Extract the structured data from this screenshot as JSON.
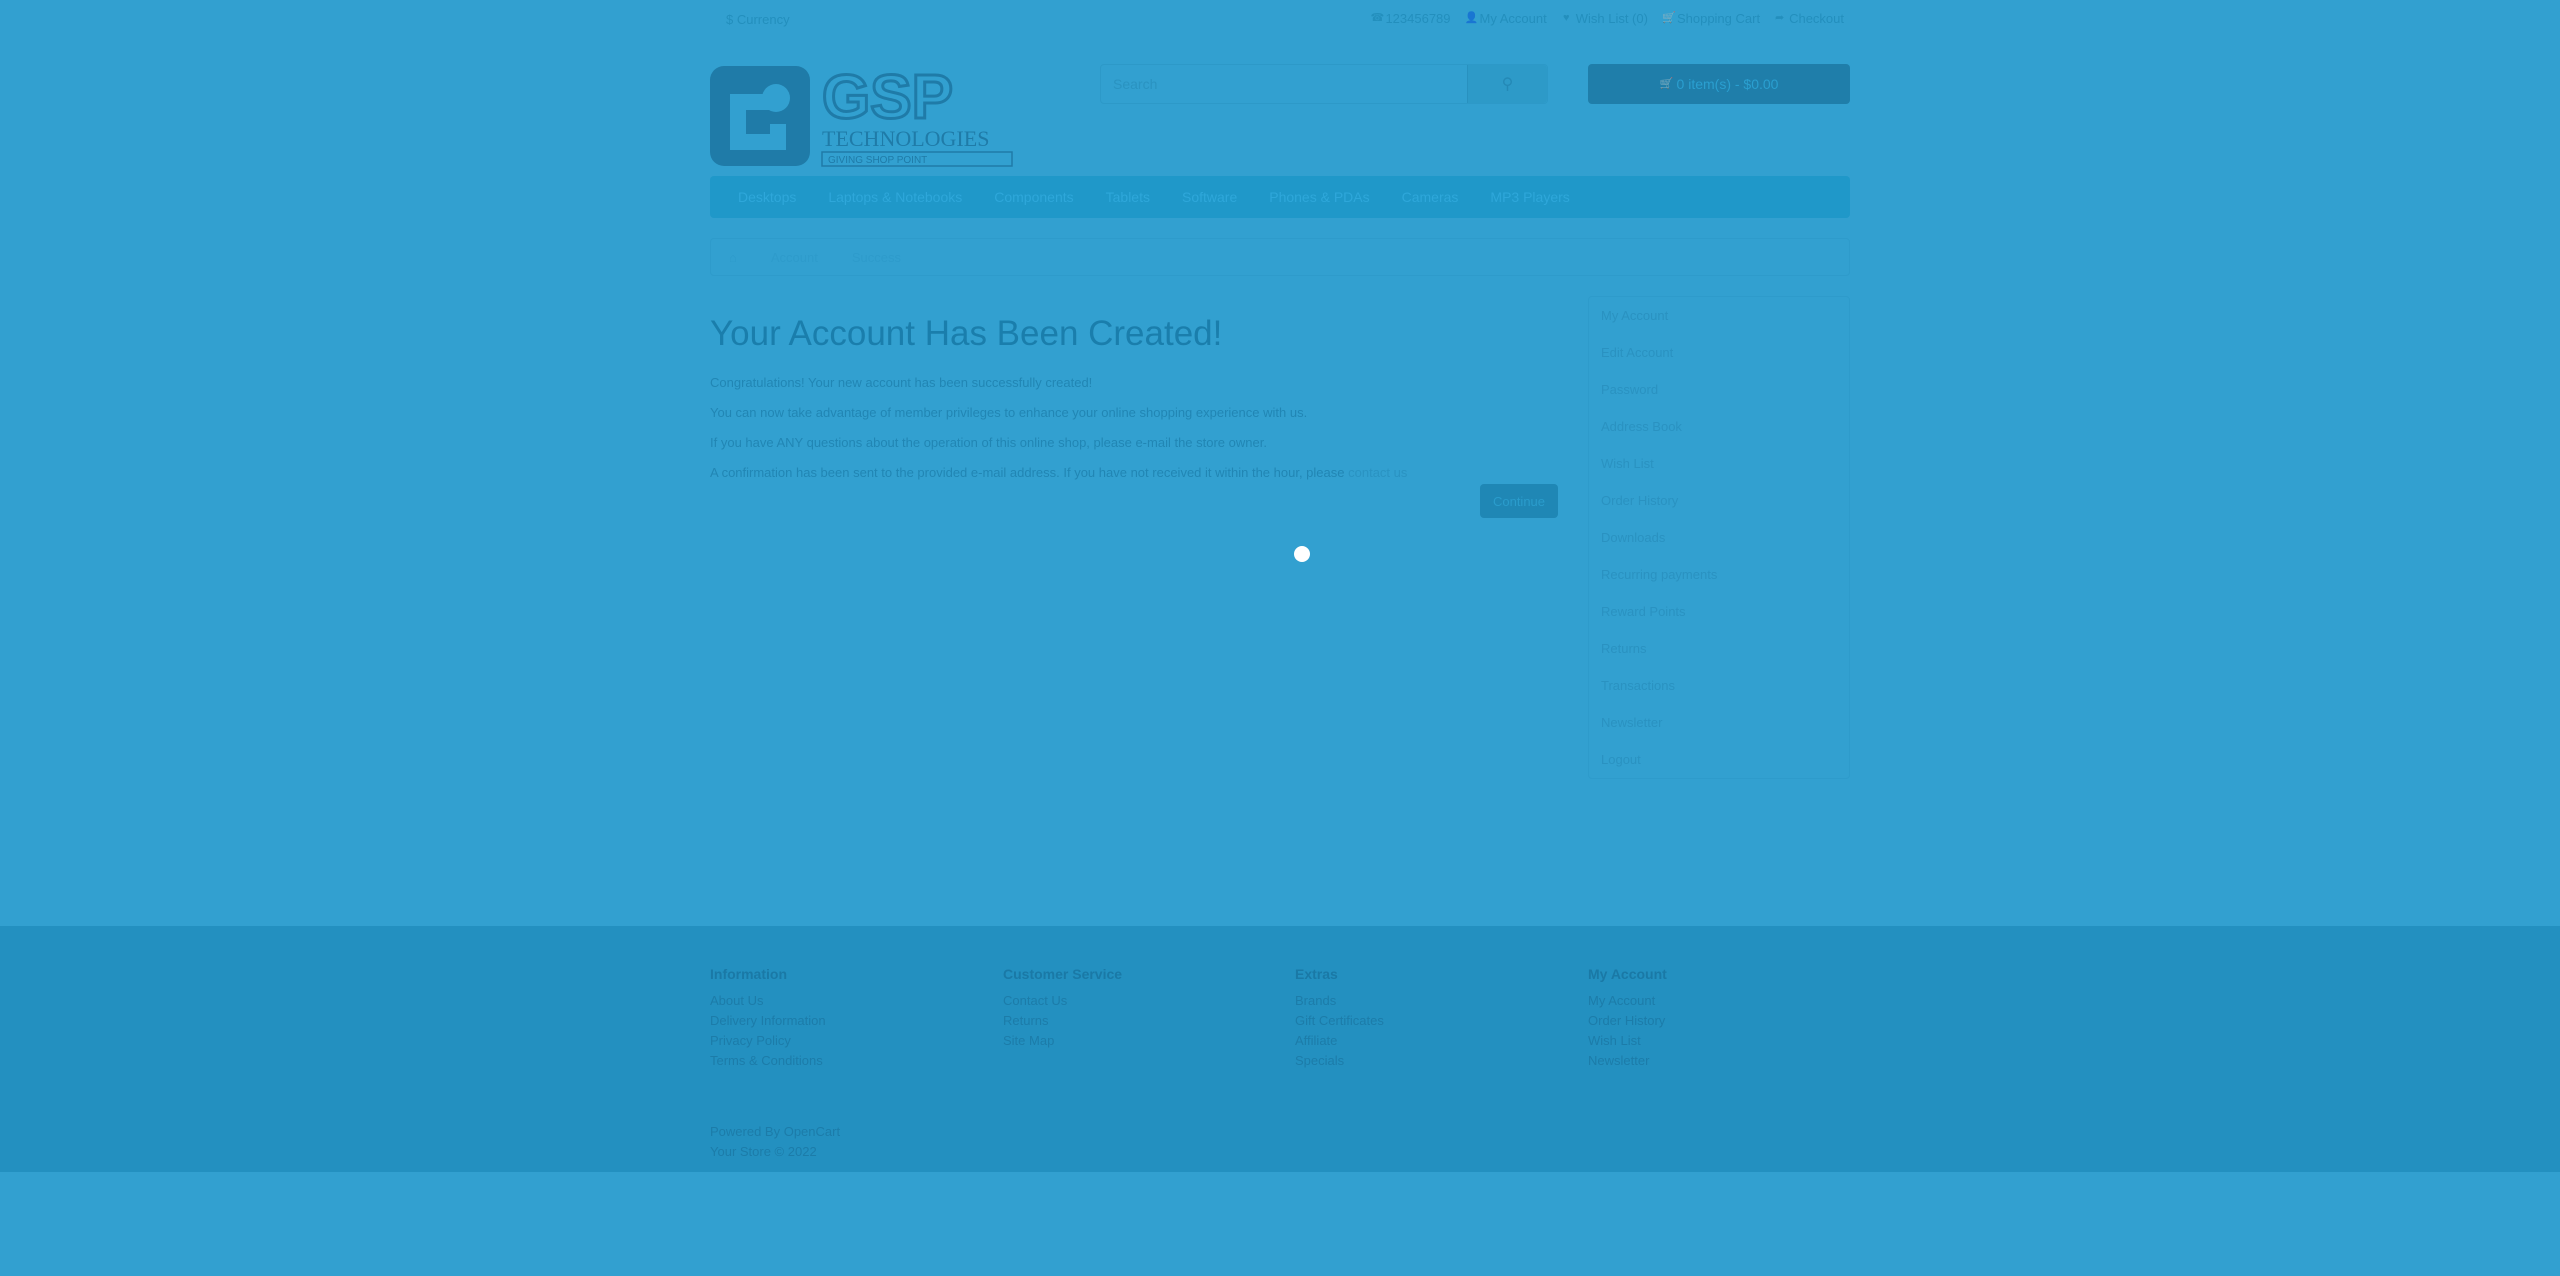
{
  "topbar": {
    "currency": "$ Currency",
    "links": [
      {
        "icon": "phone-icon",
        "label": "123456789"
      },
      {
        "icon": "user-icon",
        "label": "My Account"
      },
      {
        "icon": "heart-icon",
        "label": "Wish List (0)"
      },
      {
        "icon": "cart-icon",
        "label": "Shopping Cart"
      },
      {
        "icon": "share-icon",
        "label": "Checkout"
      }
    ]
  },
  "header": {
    "logo_text": "GSP",
    "logo_subtext": "TECHNOLOGIES",
    "logo_tagline": "GIVING SHOP POINT",
    "search_placeholder": "Search",
    "cart_label": "0 item(s) - $0.00"
  },
  "menu": {
    "items": [
      "Desktops",
      "Laptops & Notebooks",
      "Components",
      "Tablets",
      "Software",
      "Phones & PDAs",
      "Cameras",
      "MP3 Players"
    ]
  },
  "breadcrumb": {
    "items": [
      "Account",
      "Success"
    ]
  },
  "content": {
    "title": "Your Account Has Been Created!",
    "p1": "Congratulations! Your new account has been successfully created!",
    "p2": "You can now take advantage of member privileges to enhance your online shopping experience with us.",
    "p3": "If you have ANY questions about the operation of this online shop, please e-mail the store owner.",
    "p4": "A confirmation has been sent to the provided e-mail address. If you have not received it within the hour, please",
    "p4_link": "contact us",
    "continue_label": "Continue"
  },
  "sidebar": {
    "items": [
      "My Account",
      "Edit Account",
      "Password",
      "Address Book",
      "Wish List",
      "Order History",
      "Downloads",
      "Recurring payments",
      "Reward Points",
      "Returns",
      "Transactions",
      "Newsletter",
      "Logout"
    ]
  },
  "footer": {
    "columns": [
      {
        "title": "Information",
        "links": [
          "About Us",
          "Delivery Information",
          "Privacy Policy",
          "Terms & Conditions"
        ]
      },
      {
        "title": "Customer Service",
        "links": [
          "Contact Us",
          "Returns",
          "Site Map"
        ]
      },
      {
        "title": "Extras",
        "links": [
          "Brands",
          "Gift Certificates",
          "Affiliate",
          "Specials"
        ]
      },
      {
        "title": "My Account",
        "links": [
          "My Account",
          "Order History",
          "Wish List",
          "Newsletter"
        ]
      }
    ],
    "powered": "Powered By OpenCart",
    "copyright": "Your Store © 2022"
  },
  "colors": {
    "overlay": "#32a0d0",
    "menu": "#1f98c9",
    "footer": "#2390c0"
  }
}
